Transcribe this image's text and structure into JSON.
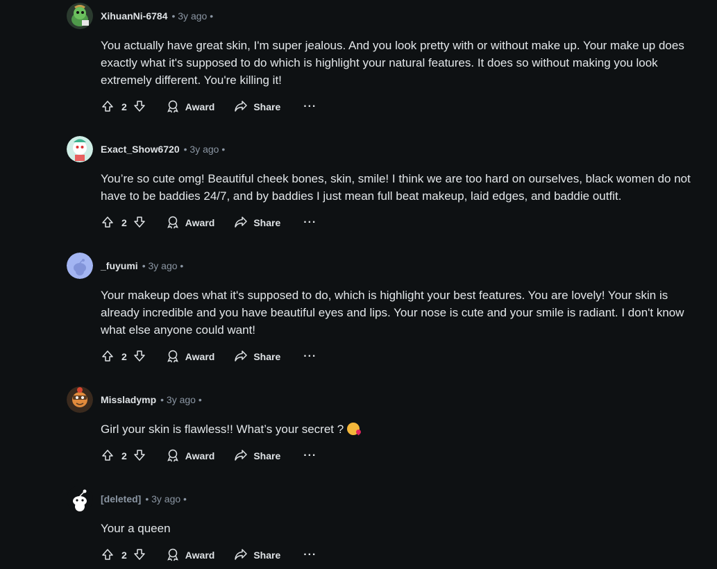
{
  "comments": [
    {
      "author": "XihuanNi-6784",
      "time": "• 3y ago •",
      "body": "You actually have great skin, I'm super jealous. And you look pretty with or without make up. Your make up does exactly what it's supposed to do which is highlight your natural features. It does so without making you look extremely different. You're killing it!",
      "votes": "2",
      "avatar_color": "#4f7a4a"
    },
    {
      "author": "Exact_Show6720",
      "time": "• 3y ago •",
      "body": "You’re so cute omg! Beautiful cheek bones, skin, smile! I think we are too hard on ourselves, black women do not have to be baddies 24/7, and by baddies I just mean full beat makeup, laid edges, and baddie outfit.",
      "votes": "2",
      "avatar_color": "#7fc7b6"
    },
    {
      "author": "_fuyumi",
      "time": "• 3y ago •",
      "body": "Your makeup does what it's supposed to do, which is highlight your best features. You are lovely! Your skin is already incredible and you have beautiful eyes and lips. Your nose is cute and your smile is radiant. I don't know what else anyone could want!",
      "votes": "2",
      "avatar_color": "#a3b5f2"
    },
    {
      "author": "Missladymp",
      "time": "• 3y ago •",
      "body": "Girl your skin is flawless!! What’s your secret ?",
      "votes": "2",
      "avatar_color": "#c06b2c",
      "emoji": "face-blowing-kiss-emoji"
    },
    {
      "author": "[deleted]",
      "time": "• 3y ago •",
      "body": "Your a queen",
      "votes": "2",
      "avatar_color": "#ffffff",
      "deleted": true
    }
  ],
  "actions": {
    "award_label": "Award",
    "share_label": "Share",
    "more_label": "···"
  },
  "colors": {
    "background": "#0e1113",
    "text": "#dfe3e6",
    "muted": "#8b96a3"
  }
}
